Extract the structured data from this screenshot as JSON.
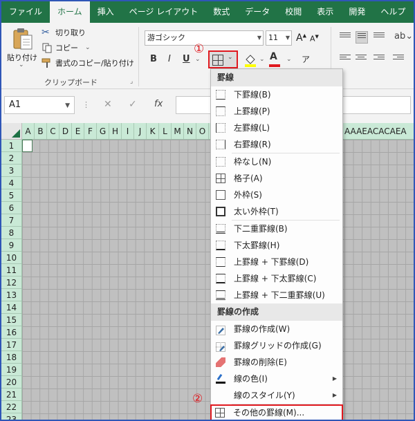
{
  "ribbon_tabs": [
    "ファイル",
    "ホーム",
    "挿入",
    "ページ レイアウト",
    "数式",
    "データ",
    "校閲",
    "表示",
    "開発",
    "ヘルプ"
  ],
  "active_tab_index": 1,
  "clipboard": {
    "paste_label": "貼り付け",
    "cut_label": "切り取り",
    "copy_label": "コピー",
    "format_painter_label": "書式のコピー/貼り付け",
    "group_label": "クリップボード"
  },
  "font": {
    "name": "游ゴシック",
    "size": "11",
    "bold": "B",
    "italic": "I",
    "underline": "U",
    "grow": "A",
    "shrink": "A",
    "font_color": "A",
    "phonetic": "ア"
  },
  "markers": {
    "step1": "①",
    "step2": "②"
  },
  "formula_bar": {
    "name_box": "A1",
    "fx_label": "fx"
  },
  "sheet": {
    "columns": [
      "A",
      "B",
      "C",
      "D",
      "E",
      "F",
      "G",
      "H",
      "I",
      "J",
      "K",
      "L",
      "M",
      "N",
      "O"
    ],
    "columns_right": "AAAEACACAEA",
    "rows": [
      "1",
      "2",
      "3",
      "4",
      "5",
      "6",
      "7",
      "8",
      "9",
      "10",
      "11",
      "12",
      "13",
      "14",
      "15",
      "16",
      "17",
      "18",
      "19",
      "20",
      "21",
      "22",
      "23"
    ]
  },
  "border_menu": {
    "section1_title": "罫線",
    "items_group1": [
      "下罫線(B)",
      "上罫線(P)",
      "左罫線(L)",
      "右罫線(R)"
    ],
    "items_group2": [
      "枠なし(N)",
      "格子(A)",
      "外枠(S)",
      "太い外枠(T)"
    ],
    "items_group3": [
      "下二重罫線(B)",
      "下太罫線(H)",
      "上罫線 + 下罫線(D)",
      "上罫線 + 下太罫線(C)",
      "上罫線 + 下二重罫線(U)"
    ],
    "section2_title": "罫線の作成",
    "draw_items": [
      "罫線の作成(W)",
      "罫線グリッドの作成(G)",
      "罫線の削除(E)",
      "線の色(I)",
      "線のスタイル(Y)"
    ],
    "more_borders": "その他の罫線(M)..."
  }
}
